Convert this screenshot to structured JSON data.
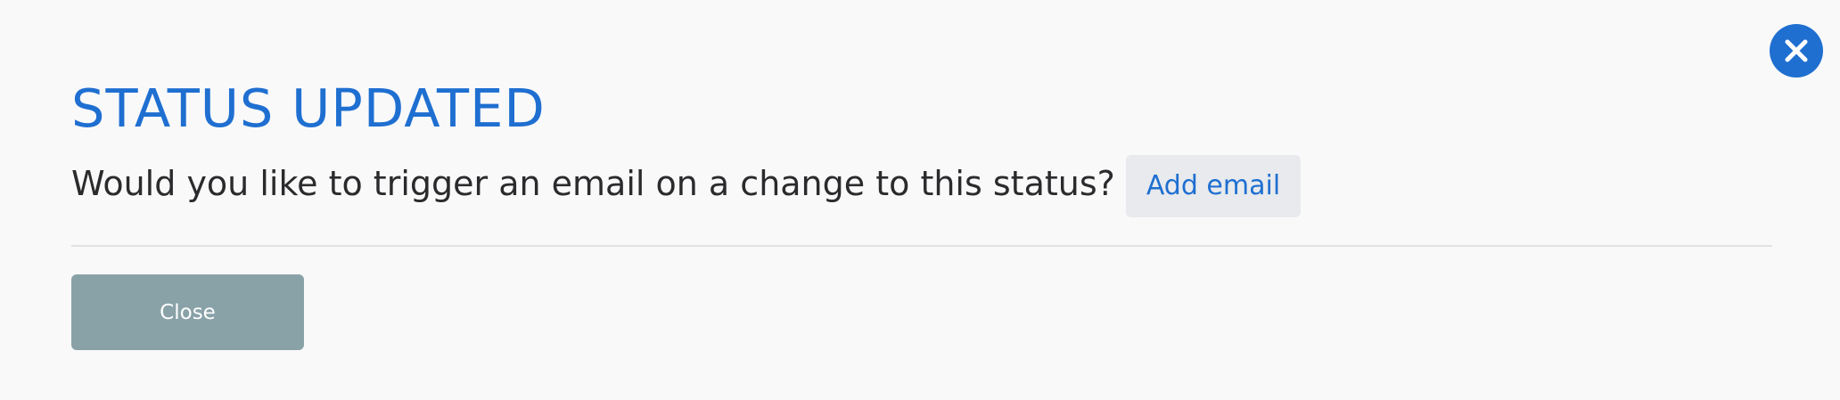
{
  "dialog": {
    "title": "STATUS UPDATED",
    "question": "Would you like to trigger an email on a change to this status?",
    "add_email_label": "Add email",
    "close_label": "Close"
  },
  "icons": {
    "dismiss": "close-icon"
  },
  "colors": {
    "accent": "#1f6fd1",
    "close_button_bg": "#89a2a8",
    "add_email_bg": "#e8eaed",
    "background": "#f9f9fa",
    "text": "#2b2b2d",
    "divider": "#e1e2e4"
  }
}
